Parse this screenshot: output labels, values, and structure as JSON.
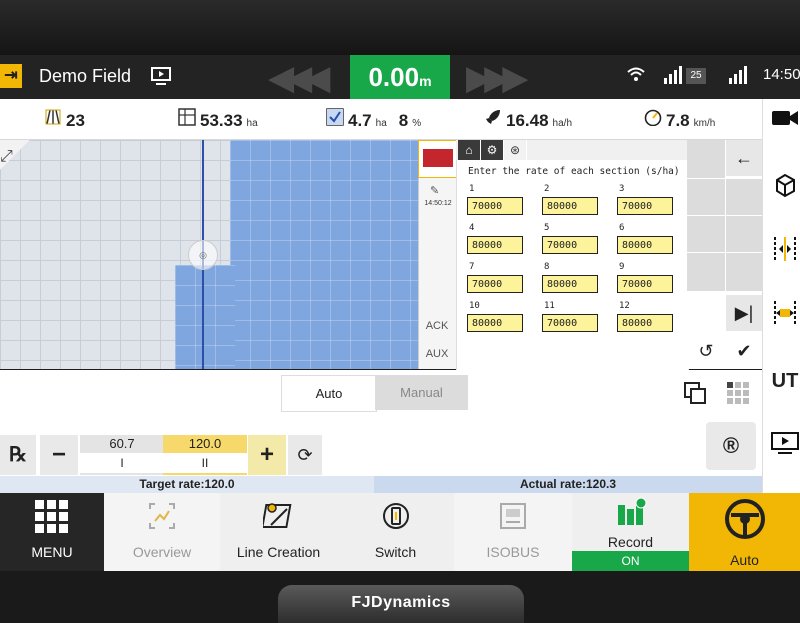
{
  "status": {
    "title": "Demo Field",
    "speed_value": "0.00",
    "speed_unit": "m",
    "signal_count": "25",
    "time": "14:50"
  },
  "stats": {
    "passes": "23",
    "area_total": "53.33",
    "area_total_unit": "ha",
    "area_done": "4.7",
    "area_done_unit": "ha",
    "percent": "8",
    "percent_unit": "%",
    "work_rate": "16.48",
    "work_rate_unit": "ha/h",
    "speed": "7.8",
    "speed_unit": "km/h"
  },
  "side_strip": {
    "time": "14:50:12",
    "ack_label": "ACK",
    "aux_label": "AUX"
  },
  "rate_dialog": {
    "title": "Enter the rate of each section (s/ha)",
    "sections": [
      {
        "label": "1",
        "value": "70000"
      },
      {
        "label": "2",
        "value": "80000"
      },
      {
        "label": "3",
        "value": "70000"
      },
      {
        "label": "4",
        "value": "80000"
      },
      {
        "label": "5",
        "value": "70000"
      },
      {
        "label": "6",
        "value": "80000"
      },
      {
        "label": "7",
        "value": "70000"
      },
      {
        "label": "8",
        "value": "80000"
      },
      {
        "label": "9",
        "value": "70000"
      },
      {
        "label": "10",
        "value": "80000"
      },
      {
        "label": "11",
        "value": "70000"
      },
      {
        "label": "12",
        "value": "80000"
      }
    ]
  },
  "mode": {
    "auto_label": "Auto",
    "manual_label": "Manual"
  },
  "rate_control": {
    "rate_one_value": "60.7",
    "rate_one_label": "I",
    "rate_two_value": "120.0",
    "rate_two_label": "II"
  },
  "rates": {
    "target": "Target rate:120.0",
    "actual": "Actual rate:120.3"
  },
  "right_toolbar": {
    "ut_label": "UT"
  },
  "bottom_nav": {
    "menu": "MENU",
    "overview": "Overview",
    "line_creation": "Line Creation",
    "switch": "Switch",
    "isobus": "ISOBUS",
    "record": "Record",
    "record_state": "ON",
    "auto": "Auto"
  },
  "brand": "FJDynamics",
  "colors": {
    "speed_green": "#18a84a",
    "auto_yellow": "#f2b705",
    "input_yellow": "#fcf39b",
    "coverage_blue": "#7fa6df"
  }
}
